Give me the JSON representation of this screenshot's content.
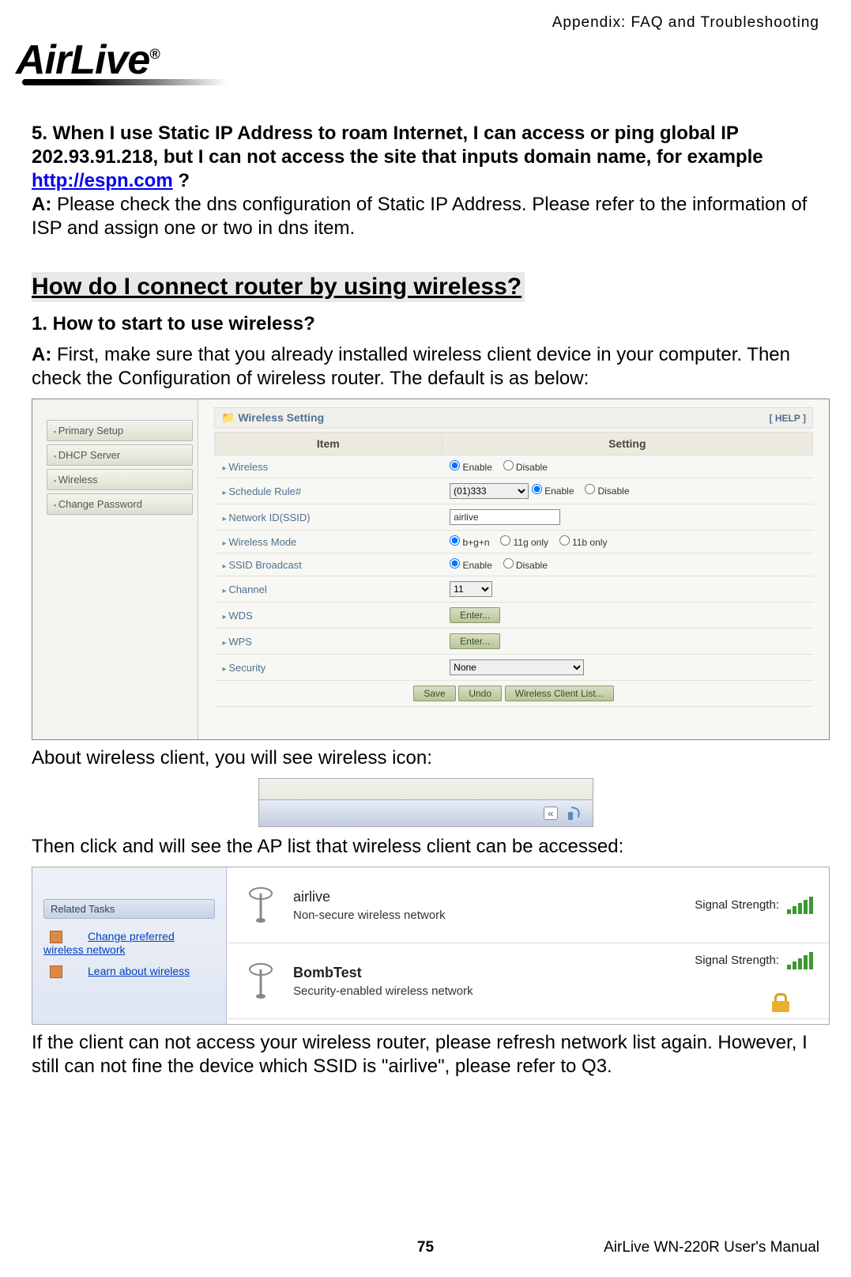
{
  "header": {
    "appendix": "Appendix: FAQ and Troubleshooting"
  },
  "logo": {
    "brand": "AirLive",
    "reg": "®"
  },
  "q5": {
    "line1": "5. When I use Static IP Address to roam Internet, I can access or ping global IP",
    "line2": "202.93.91.218, but I can not access the site that inputs domain name, for example",
    "link": "http://espn.com",
    "qmark": " ?",
    "a_label": "A:",
    "a_text": " Please check the dns configuration of Static IP Address. Please refer to the information of ISP and assign one or two in dns item."
  },
  "section_heading": "How do I connect router by using wireless?",
  "q1": {
    "title": "1. How to start to use wireless?",
    "a_label": "A:",
    "a_text": " First, make sure that you already installed wireless client device in your computer. Then check the Configuration of wireless router. The default is as below:"
  },
  "router": {
    "sidebar": [
      "Primary Setup",
      "DHCP Server",
      "Wireless",
      "Change Password"
    ],
    "panel_title": "Wireless Setting",
    "help": "[ HELP ]",
    "col_item": "Item",
    "col_setting": "Setting",
    "rows": {
      "wireless": "Wireless",
      "schedule": "Schedule Rule#",
      "ssid": "Network ID(SSID)",
      "mode": "Wireless Mode",
      "broadcast": "SSID Broadcast",
      "channel": "Channel",
      "wds": "WDS",
      "wps": "WPS",
      "security": "Security"
    },
    "values": {
      "schedule_select": "(01)333",
      "ssid_value": "airlive",
      "mode_opts": {
        "bgn": "b+g+n",
        "g": "11g only",
        "b": "11b only"
      },
      "enable": "Enable",
      "disable": "Disable",
      "channel_value": "11",
      "enter": "Enter...",
      "security_value": "None",
      "save": "Save",
      "undo": "Undo",
      "client_list": "Wireless Client List..."
    }
  },
  "caption_icon": "About wireless client, you will see wireless icon:",
  "tray": {
    "chevron": "«"
  },
  "caption_aplist": "Then click and will see the AP list that wireless client can be accessed:",
  "ap": {
    "side_head": "Related Tasks",
    "link1": "Change preferred wireless network",
    "link2": "Learn about wireless",
    "n1_name": "airlive",
    "n1_desc": "Non-secure wireless network",
    "n2_name": "BombTest",
    "n2_desc": "Security-enabled wireless network",
    "sig_label": "Signal Strength:"
  },
  "tail": "If the client can not access your wireless router, please refresh network list again. However, I still can not fine the device which SSID is \"airlive\", please refer to Q3.",
  "footer": {
    "page": "75",
    "doc": "AirLive WN-220R User's Manual"
  }
}
